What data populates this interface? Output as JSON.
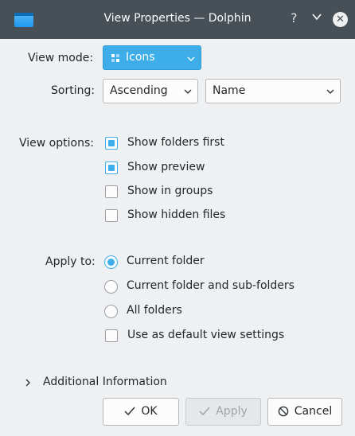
{
  "window": {
    "title": "View Properties — Dolphin",
    "help_glyph": "?"
  },
  "view_mode": {
    "label": "View mode:",
    "value": "Icons"
  },
  "sorting": {
    "label": "Sorting:",
    "order": "Ascending",
    "field": "Name"
  },
  "view_options": {
    "label": "View options:",
    "items": [
      {
        "label": "Show folders first",
        "checked": true
      },
      {
        "label": "Show preview",
        "checked": true
      },
      {
        "label": "Show in groups",
        "checked": false
      },
      {
        "label": "Show hidden files",
        "checked": false
      }
    ]
  },
  "apply_to": {
    "label": "Apply to:",
    "options": [
      {
        "label": "Current folder",
        "selected": true
      },
      {
        "label": "Current folder and sub-folders",
        "selected": false
      },
      {
        "label": "All folders",
        "selected": false
      }
    ],
    "default_checkbox": {
      "label": "Use as default view settings",
      "checked": false
    }
  },
  "additional_info": {
    "label": "Additional Information"
  },
  "buttons": {
    "ok": "OK",
    "apply": "Apply",
    "cancel": "Cancel"
  },
  "colors": {
    "accent": "#3daee9",
    "titlebar": "#475057",
    "window_bg": "#eff0f1"
  }
}
